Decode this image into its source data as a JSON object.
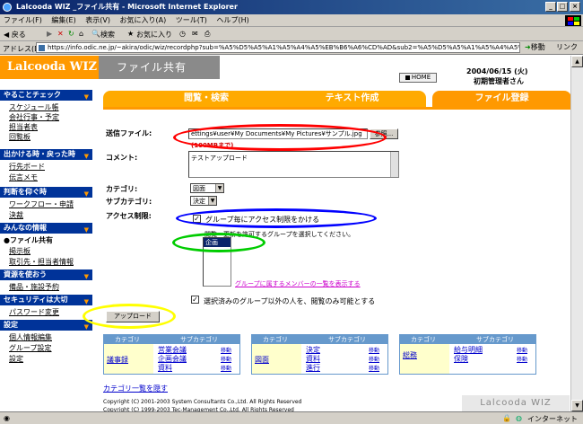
{
  "window": {
    "title": "Lalcooda WIZ _ファイル共有 - Microsoft Internet Explorer"
  },
  "menu": [
    "ファイル(F)",
    "編集(E)",
    "表示(V)",
    "お気に入り(A)",
    "ツール(T)",
    "ヘルプ(H)"
  ],
  "toolbar": {
    "back": "◀ 戻る",
    "search": "検索",
    "favorites": "お気に入り"
  },
  "address": {
    "label": "アドレス(D)",
    "url": "https://info.odic.ne.jp/~akira/odic/wiz/recordphp?sub=%A5%D5%A5%A1%A5%A4%A5%EB%B6%A6%CD%AD&sub2=%A5%D5%A5%A1%A5%A4%A5%EB%C5%D0%CF%BF",
    "go": "移動",
    "links": "リンク"
  },
  "header": {
    "logo": "Lalcooda WIZ",
    "app_title": "ファイル共有",
    "home": "HOME",
    "date": "2004/06/15 (火)",
    "user": "初期管理者さん"
  },
  "sidebar": {
    "sections": [
      {
        "title": "やることチェック",
        "items": [
          "スケジュール帳",
          "会社行事・予定",
          "担当者表",
          "回覧板"
        ]
      },
      {
        "title": "出かける時・戻った時",
        "items": [
          "行先ボード",
          "伝言メモ"
        ]
      },
      {
        "title": "判断を仰ぐ時",
        "items": [
          "ワークフロー・申請",
          "決裁"
        ]
      },
      {
        "title": "みんなの情報",
        "items": [
          "●ファイル共有",
          "掲示板",
          "取引先・担当者情報"
        ]
      },
      {
        "title": "資源を使おう",
        "items": [
          "備品・施設予約"
        ]
      },
      {
        "title": "セキュリティは大切",
        "items": [
          "パスワード変更"
        ]
      },
      {
        "title": "設定",
        "items": [
          "個人情報編集",
          "グループ設定",
          "設定"
        ]
      }
    ]
  },
  "tabs": [
    "閲覧・検索",
    "テキスト作成",
    "ファイル登録"
  ],
  "form": {
    "file_label": "送信ファイル:",
    "file_value": "ettings¥user¥My Documents¥My Pictures¥サンプル.jpg",
    "file_note": "(100MBまで)",
    "browse": "参照...",
    "comment_label": "コメント:",
    "comment_value": "テストアップロード",
    "category_label": "カテゴリ:",
    "category_value": "図面",
    "subcategory_label": "サブカテゴリ:",
    "subcategory_value": "決定",
    "access_label": "アクセス制限:",
    "access_check": "グループ毎にアクセス制限をかける",
    "access_instruction": "閲覧・更新を許可するグループを選択してください。",
    "groups": [
      "企画"
    ],
    "member_link": "グループに属するメンバーの一覧を表示する",
    "other_check": "選択済みのグループ以外の人を、閲覧のみ可能とする",
    "upload": "アップロード"
  },
  "categories": [
    {
      "header_cat": "カテゴリ",
      "header_sub": "サブカテゴリ",
      "category": "議事録",
      "subs": [
        "営業会議",
        "企画会議",
        "資料"
      ],
      "move": "移動"
    },
    {
      "header_cat": "カテゴリ",
      "header_sub": "サブカテゴリ",
      "category": "図面",
      "subs": [
        "決定",
        "資料",
        "進行"
      ],
      "move": "移動"
    },
    {
      "header_cat": "カテゴリ",
      "header_sub": "サブカテゴリ",
      "category": "総務",
      "subs": [
        "給与明細",
        "保険"
      ],
      "move": "移動"
    }
  ],
  "footer": {
    "hide_link": "カテゴリ一覧を隠す",
    "copy1": "Copyright (C) 2001-2003 System Consultants Co.,Ltd. All Rights Reserved",
    "copy2": "Copyright (C) 1999-2003 Tec-Management Co.,Ltd. All Rights Reserved",
    "logo": "Lalcooda WIZ"
  },
  "status": {
    "zone": "インターネット"
  },
  "colors": {
    "annotation_red": "#ff0000",
    "annotation_blue": "#0000ff",
    "annotation_green": "#00cc00",
    "annotation_yellow": "#ffff00",
    "accent": "#ff9900",
    "nav": "#003399"
  }
}
